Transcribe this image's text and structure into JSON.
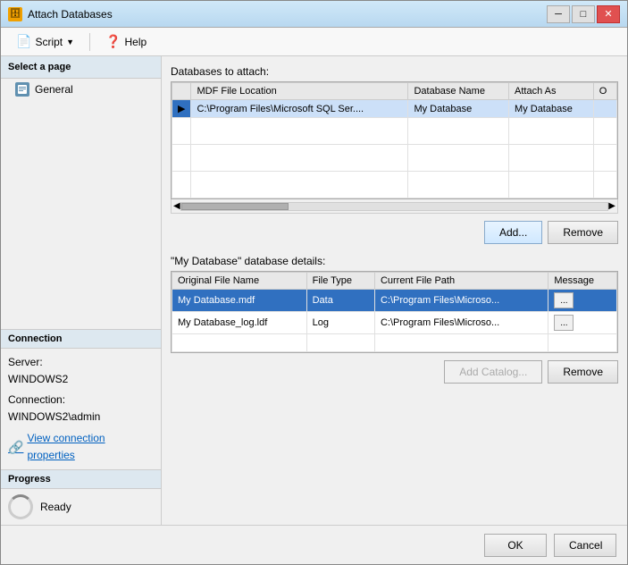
{
  "window": {
    "title": "Attach Databases",
    "icon": "🗄"
  },
  "title_controls": {
    "minimize": "─",
    "maximize": "□",
    "close": "✕"
  },
  "toolbar": {
    "script_label": "Script",
    "help_label": "Help"
  },
  "left_panel": {
    "select_page_header": "Select a page",
    "general_item": "General",
    "connection_header": "Connection",
    "server_label": "Server:",
    "server_value": "WINDOWS2",
    "connection_label": "Connection:",
    "connection_value": "WINDOWS2\\admin",
    "view_properties_link": "View connection properties",
    "progress_header": "Progress",
    "progress_status": "Ready"
  },
  "main": {
    "databases_to_attach_label": "Databases to attach:",
    "table_headers": [
      "MDF File Location",
      "Database Name",
      "Attach As",
      "O"
    ],
    "table_rows": [
      {
        "mdf_location": "C:\\Program Files\\Microsoft SQL Ser....",
        "database_name": "My Database",
        "attach_as": "My Database",
        "owner": ""
      }
    ],
    "add_button": "Add...",
    "remove_button": "Remove",
    "db_details_label": "\"My Database\" database details:",
    "details_headers": [
      "Original File Name",
      "File Type",
      "Current File Path",
      "Message"
    ],
    "details_rows": [
      {
        "file_name": "My Database.mdf",
        "file_type": "Data",
        "file_path": "C:\\Program Files\\Microso...",
        "message": "..."
      },
      {
        "file_name": "My Database_log.ldf",
        "file_type": "Log",
        "file_path": "C:\\Program Files\\Microso...",
        "message": "..."
      }
    ],
    "add_catalog_button": "Add Catalog...",
    "remove_details_button": "Remove"
  },
  "footer": {
    "ok_button": "OK",
    "cancel_button": "Cancel"
  }
}
